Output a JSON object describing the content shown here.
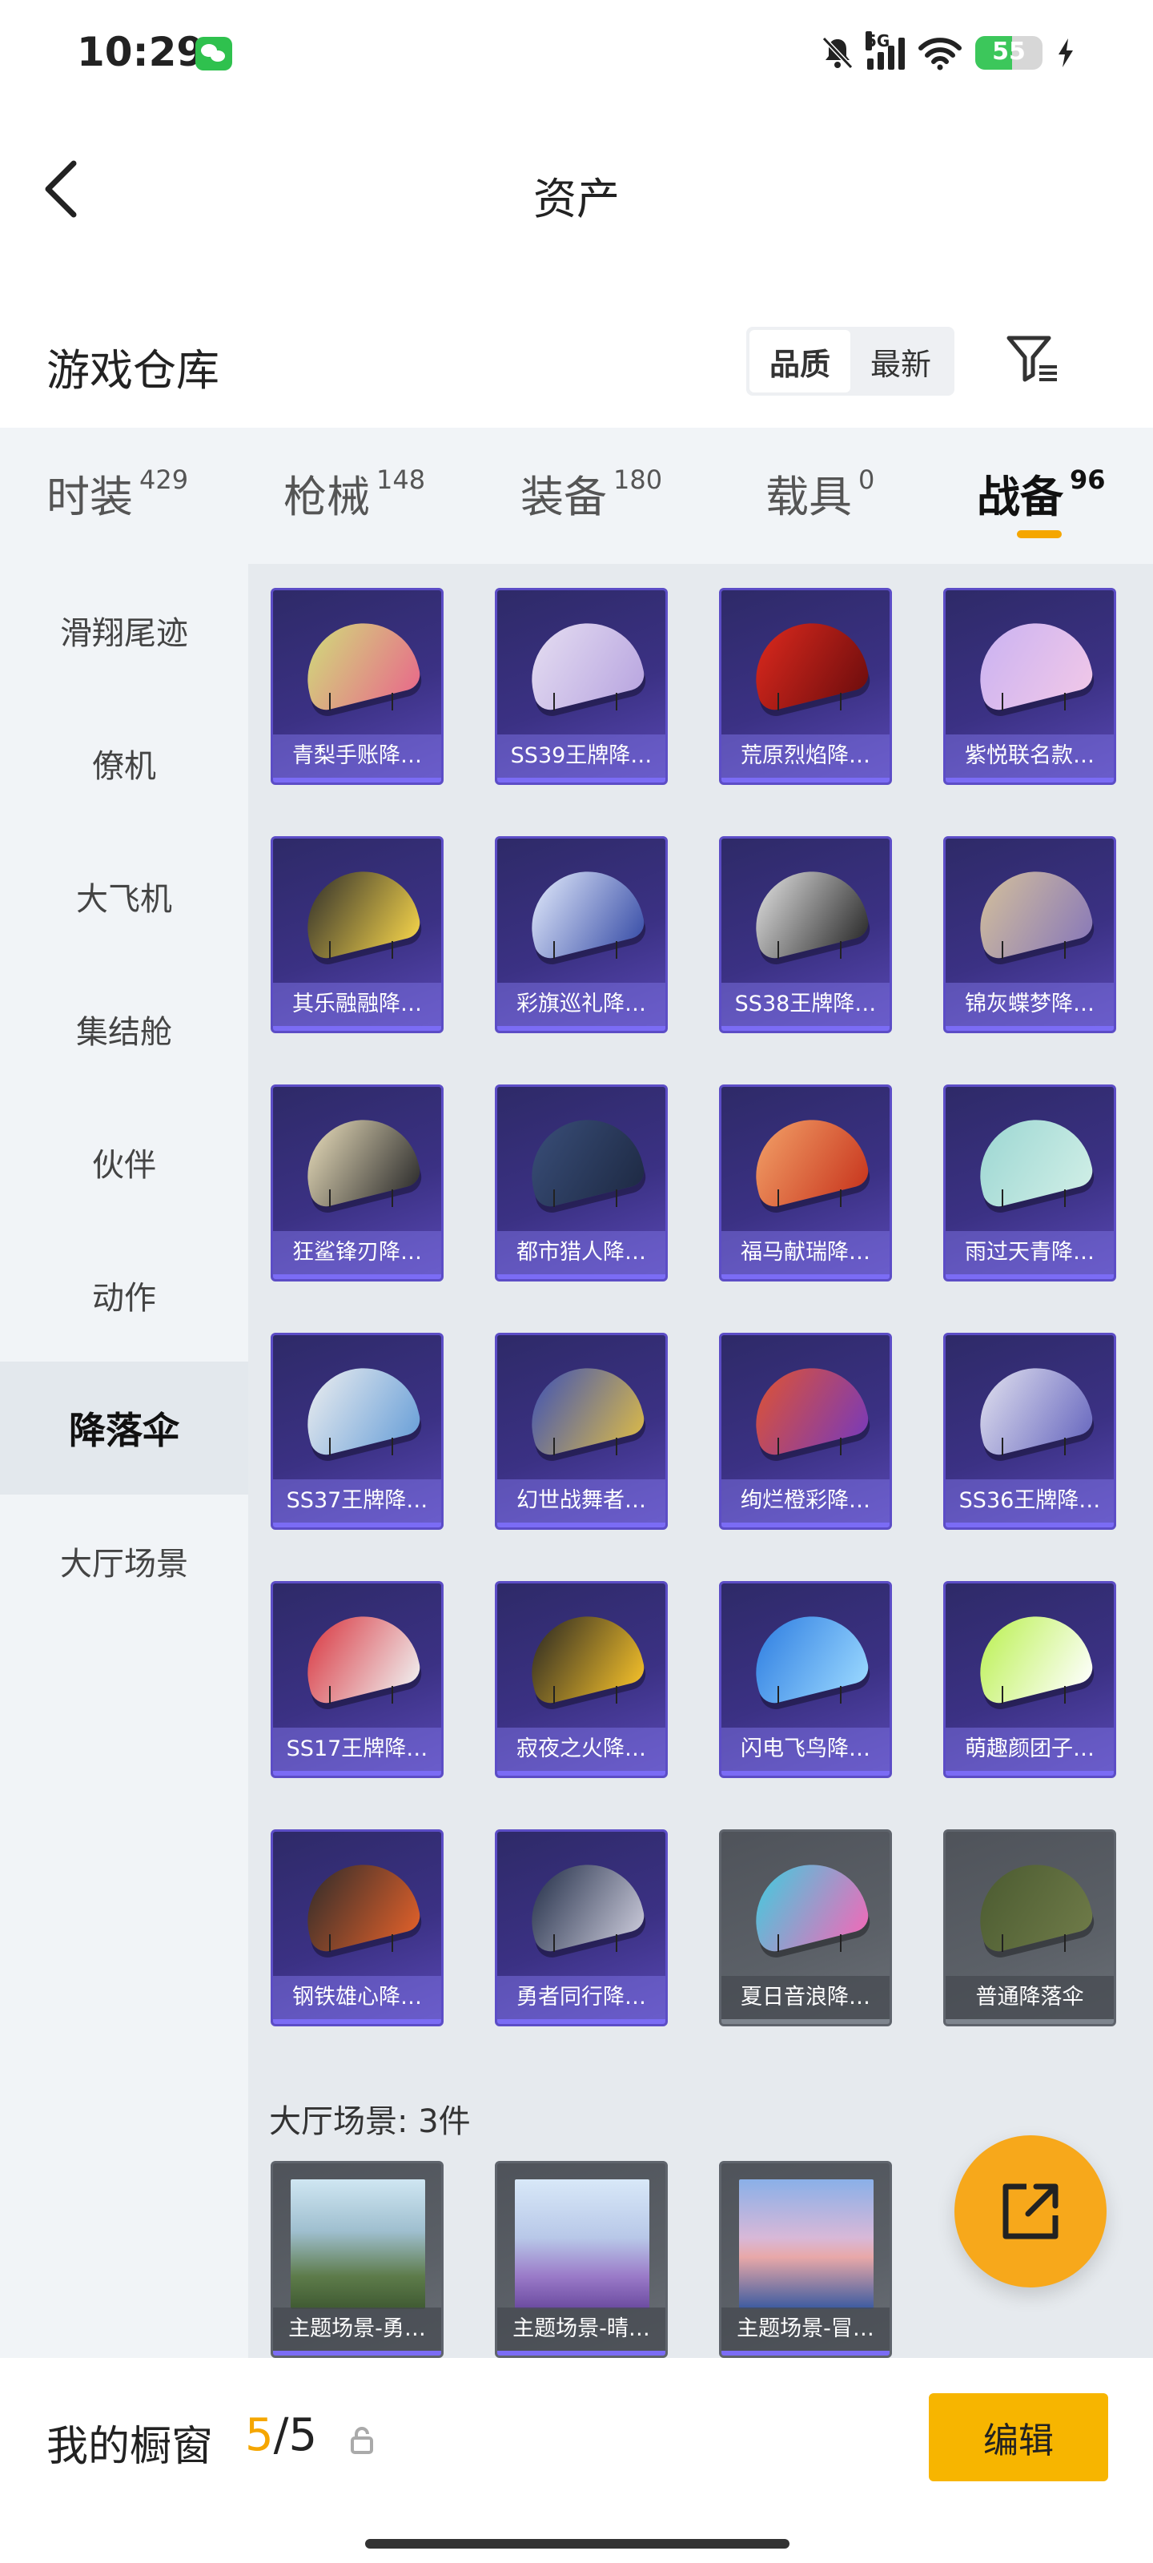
{
  "status_bar": {
    "time": "10:29",
    "network": "5G",
    "battery": "55"
  },
  "header": {
    "title": "资产"
  },
  "section": {
    "title": "游戏仓库",
    "sort_options": [
      "品质",
      "最新"
    ],
    "active_sort": "品质"
  },
  "tabs": [
    {
      "label": "时装",
      "count": "429"
    },
    {
      "label": "枪械",
      "count": "148"
    },
    {
      "label": "装备",
      "count": "180"
    },
    {
      "label": "载具",
      "count": "0"
    },
    {
      "label": "战备",
      "count": "96",
      "active": true
    }
  ],
  "sidebar": {
    "items": [
      "滑翔尾迹",
      "僚机",
      "大飞机",
      "集结舱",
      "伙伴",
      "动作",
      "降落伞",
      "大厅场景"
    ],
    "active": "降落伞"
  },
  "parachutes": [
    {
      "label": "青梨手账降…"
    },
    {
      "label": "SS39王牌降…"
    },
    {
      "label": "荒原烈焰降…"
    },
    {
      "label": "紫悦联名款…"
    },
    {
      "label": "其乐融融降…"
    },
    {
      "label": "彩旗巡礼降…"
    },
    {
      "label": "SS38王牌降…"
    },
    {
      "label": "锦灰蝶梦降…"
    },
    {
      "label": "狂鲨锋刃降…"
    },
    {
      "label": "都市猎人降…"
    },
    {
      "label": "福马献瑞降…"
    },
    {
      "label": "雨过天青降…"
    },
    {
      "label": "SS37王牌降…"
    },
    {
      "label": "幻世战舞者…"
    },
    {
      "label": "绚烂橙彩降…"
    },
    {
      "label": "SS36王牌降…"
    },
    {
      "label": "SS17王牌降…"
    },
    {
      "label": "寂夜之火降…"
    },
    {
      "label": "闪电飞鸟降…"
    },
    {
      "label": "萌趣颜团子…"
    },
    {
      "label": "钢铁雄心降…"
    },
    {
      "label": "勇者同行降…"
    },
    {
      "label": "夏日音浪降…"
    },
    {
      "label": "普通降落伞"
    }
  ],
  "lobby_scenes": {
    "heading": "大厅场景: 3件",
    "items": [
      {
        "label": "主题场景-勇…"
      },
      {
        "label": "主题场景-晴…"
      },
      {
        "label": "主题场景-冒…"
      }
    ]
  },
  "bottom_bar": {
    "label": "我的橱窗",
    "current": "5",
    "separator": "/",
    "total": "5",
    "edit_label": "编辑"
  },
  "colors": {
    "accent": "#f7b500",
    "card_purple": "#3b3184",
    "card_gray": "#5b6067"
  }
}
